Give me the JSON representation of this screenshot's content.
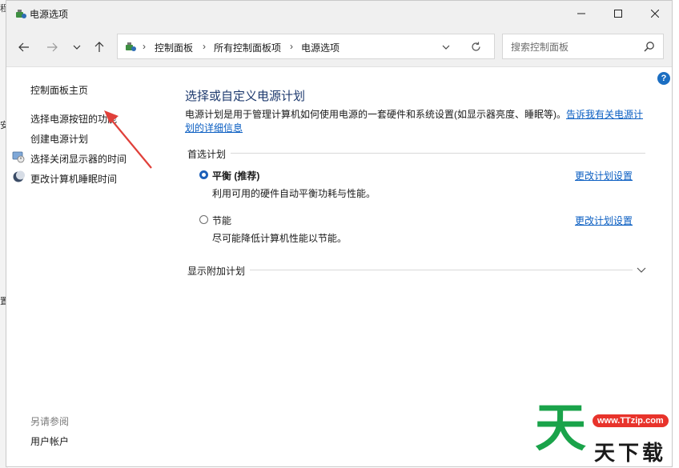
{
  "background_strip": [
    "程",
    "安",
    "置"
  ],
  "window": {
    "title": "电源选项"
  },
  "address_bar": {
    "crumbs": [
      "控制面板",
      "所有控制面板项",
      "电源选项"
    ]
  },
  "search": {
    "placeholder": "搜索控制面板"
  },
  "left_nav": {
    "home": "控制面板主页",
    "items": [
      "选择电源按钮的功能",
      "创建电源计划",
      "选择关闭显示器的时间",
      "更改计算机睡眠时间"
    ],
    "see_also": "另请参阅",
    "user_accounts": "用户帐户"
  },
  "help": "?",
  "main": {
    "title": "选择或自定义电源计划",
    "description": "电源计划是用于管理计算机如何使用电源的一套硬件和系统设置(如显示器亮度、睡眠等)。",
    "description_link": "告诉我有关电源计划的详细信息",
    "preferred_plans_label": "首选计划",
    "plans": [
      {
        "name": "平衡 (推荐)",
        "description": "利用可用的硬件自动平衡功耗与性能。",
        "link": "更改计划设置",
        "selected": true
      },
      {
        "name": "节能",
        "description": "尽可能降低计算机性能以节能。",
        "link": "更改计划设置",
        "selected": false
      }
    ],
    "show_more_label": "显示附加计划"
  },
  "watermark": {
    "big": "天",
    "url": "www.TTzip.com",
    "small": "天下载"
  },
  "colors": {
    "accent": "#0a5ec2",
    "title_blue": "#1e3a6e",
    "arrow": "#e0403a",
    "watermark_green": "#1aa34a"
  }
}
